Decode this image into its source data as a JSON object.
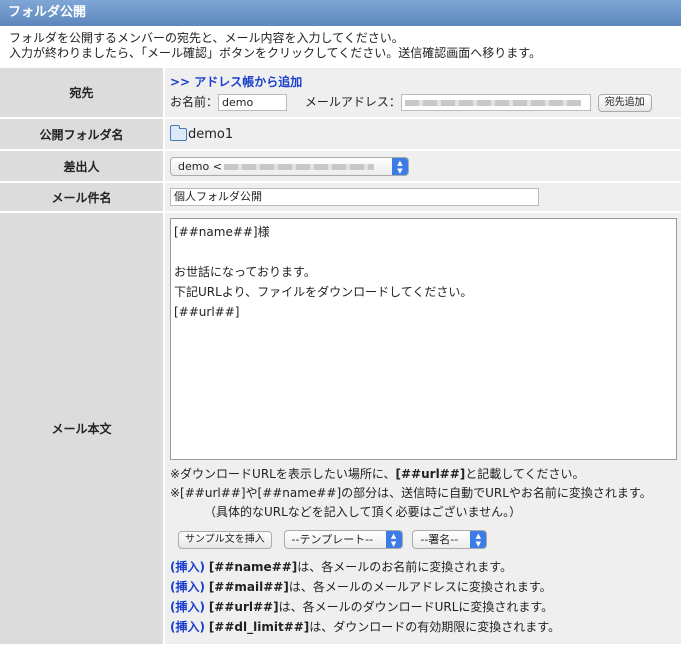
{
  "header": {
    "title": "フォルダ公開"
  },
  "intro": {
    "line1": "フォルダを公開するメンバーの宛先と、メール内容を入力してください。",
    "line2": "入力が終わりましたら、「メール確認」ボタンをクリックしてください。送信確認画面へ移ります。"
  },
  "to": {
    "label": "宛先",
    "addressbook_link": ">> アドレス帳から追加",
    "name_label": "お名前：",
    "name_value": "demo",
    "email_label": "メールアドレス：",
    "add_button": "宛先追加"
  },
  "folder": {
    "label": "公開フォルダ名",
    "name": "demo1"
  },
  "sender": {
    "label": "差出人",
    "value": "demo <"
  },
  "subject": {
    "label": "メール件名",
    "value": "個人フォルダ公開"
  },
  "body": {
    "label": "メール本文",
    "lines": [
      "[##name##]様",
      "",
      "お世話になっております。",
      "下記URLより、ファイルをダウンロードしてください。",
      "[##url##]"
    ]
  },
  "notes": {
    "n1a": "※ダウンロードURLを表示したい場所に、",
    "n1b": "[##url##]",
    "n1c": "と記載してください。",
    "n2": "※[##url##]や[##name##]の部分は、送信時に自動でURLやお名前に変換されます。",
    "n3": "（具体的なURLなどを記入して頂く必要はございません。）"
  },
  "controls": {
    "sample_button": "サンプル文を挿入",
    "template_select": "--テンプレート--",
    "signature_select": "--署名--"
  },
  "inserts": [
    {
      "tag": "(挿入)",
      "var": "[##name##]",
      "desc": "は、各メールのお名前に変換されます。"
    },
    {
      "tag": "(挿入)",
      "var": "[##mail##]",
      "desc": "は、各メールのメールアドレスに変換されます。"
    },
    {
      "tag": "(挿入)",
      "var": "[##url##]",
      "desc": "は、各メールのダウンロードURLに変換されます。"
    },
    {
      "tag": "(挿入)",
      "var": "[##dl_limit##]",
      "desc": "は、ダウンロードの有効期限に変換されます。"
    }
  ]
}
